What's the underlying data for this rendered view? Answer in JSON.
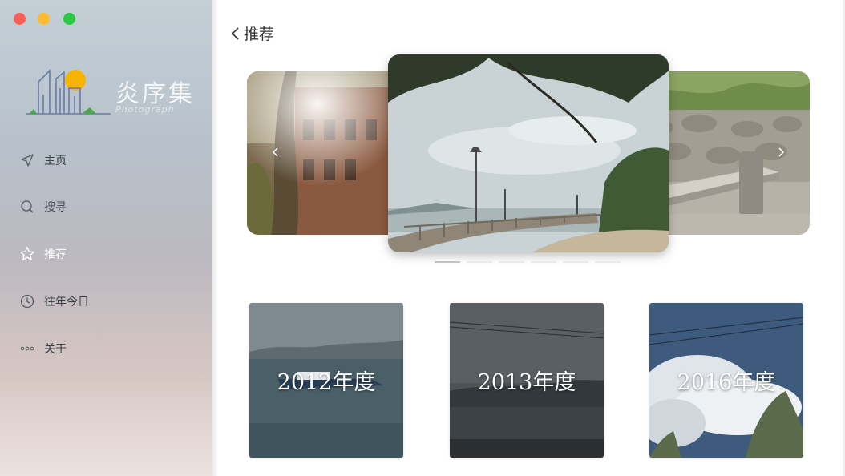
{
  "window": {
    "controls": [
      "close",
      "minimize",
      "maximize"
    ],
    "colors": {
      "close": "#fe5f57",
      "minimize": "#febc2e",
      "maximize": "#28c840"
    }
  },
  "sidebar": {
    "logo": {
      "title": "炎序集",
      "subtitle": "Photograph"
    },
    "items": [
      {
        "label": "主页",
        "icon": "send-arrow-icon",
        "active": false
      },
      {
        "label": "搜寻",
        "icon": "search-icon",
        "active": false
      },
      {
        "label": "推荐",
        "icon": "star-icon",
        "active": true
      },
      {
        "label": "往年今日",
        "icon": "clock-icon",
        "active": false
      },
      {
        "label": "关于",
        "icon": "more-dots-icon",
        "active": false
      }
    ]
  },
  "main": {
    "back_label": "推荐",
    "carousel": {
      "prev_icon": "chevron-left-icon",
      "next_icon": "chevron-right-icon",
      "slide_count": 6,
      "active_index": 0
    },
    "years": [
      {
        "label": "2012年度"
      },
      {
        "label": "2013年度"
      },
      {
        "label": "2016年度"
      }
    ]
  }
}
